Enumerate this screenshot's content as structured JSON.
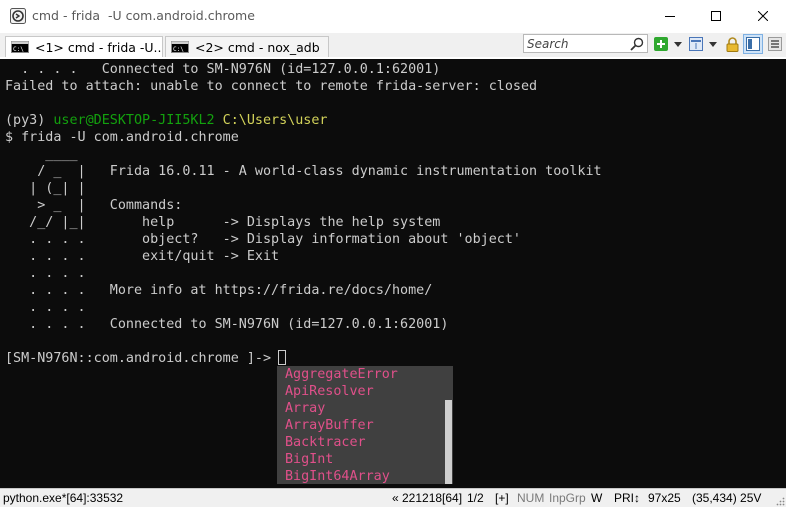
{
  "window": {
    "title": "cmd - frida  -U com.android.chrome"
  },
  "tabs": [
    {
      "label": "<1> cmd - frida  -U...",
      "active": true
    },
    {
      "label": "<2> cmd - nox_adb  ",
      "active": false
    }
  ],
  "search": {
    "placeholder": "Search"
  },
  "terminal": {
    "lines": [
      "  . . . .   Connected to SM-N976N (id=127.0.0.1:62001)",
      "Failed to attach: unable to connect to remote frida-server: closed",
      "",
      "",
      "$ frida -U com.android.chrome",
      "     ____",
      "    / _  |   Frida 16.0.11 - A world-class dynamic instrumentation toolkit",
      "   | (_| |",
      "    > _  |   Commands:",
      "   /_/ |_|       help      -> Displays the help system",
      "   . . . .       object?   -> Display information about 'object'",
      "   . . . .       exit/quit -> Exit",
      "   . . . .",
      "   . . . .   More info at https://frida.re/docs/home/",
      "   . . . .",
      "   . . . .   Connected to SM-N976N (id=127.0.0.1:62001)",
      "",
      "[SM-N976N::com.android.chrome ]-> "
    ],
    "prompt": {
      "env": "(py3) ",
      "user_host": "user@DESKTOP-JII5KL2",
      "path": " C:\\Users\\user"
    }
  },
  "autocomplete": {
    "items": [
      "AggregateError",
      "ApiResolver",
      "Array",
      "ArrayBuffer",
      "Backtracer",
      "BigInt",
      "BigInt64Array"
    ]
  },
  "status": {
    "process": "python.exe*[64]:33532",
    "pos": "« 221218[64]",
    "page": "1/2",
    "flags": "[+]",
    "num": "NUM",
    "inp": "InpGrp",
    "w": "W",
    "pri": "PRI↕",
    "size": "97x25",
    "cursor": "(35,434) 25V"
  },
  "colors": {
    "console_bg": "#0c0c0c",
    "console_fg": "#cccccc",
    "prompt_green": "#13a10e",
    "path_yellow": "#d2d25a",
    "completion_pink": "#e0508a",
    "completion_bg": "#404040"
  },
  "icons": {
    "app": "conemu-icon",
    "tab": "cmd-icon",
    "search": "search-icon",
    "new_console": "plus-icon",
    "layout": "window-layout-icon",
    "lock": "lock-icon",
    "panel": "panel-icon",
    "menu": "hamburger-icon"
  }
}
